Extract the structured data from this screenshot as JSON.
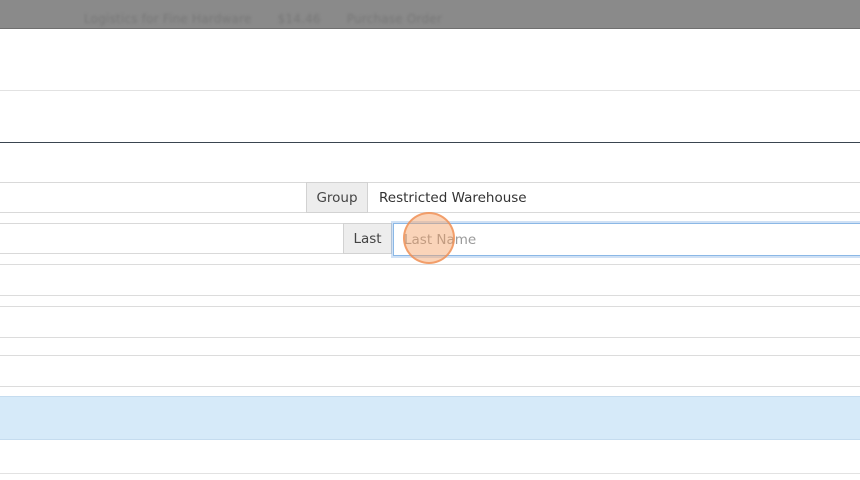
{
  "header": {
    "breadcrumbs": [
      "Logistics for Fine Hardware",
      "$14.46",
      "Purchase Order"
    ]
  },
  "form": {
    "group": {
      "label": "Group",
      "value": "Restricted Warehouse"
    },
    "last_name": {
      "label": "Last",
      "value": "",
      "placeholder": "Last Name"
    }
  },
  "colors": {
    "accent": "#8bb8e6",
    "highlight_row": "#d6eaf9",
    "header_overlay": "#8a8a8a",
    "click_indicator": "#f5a064"
  }
}
